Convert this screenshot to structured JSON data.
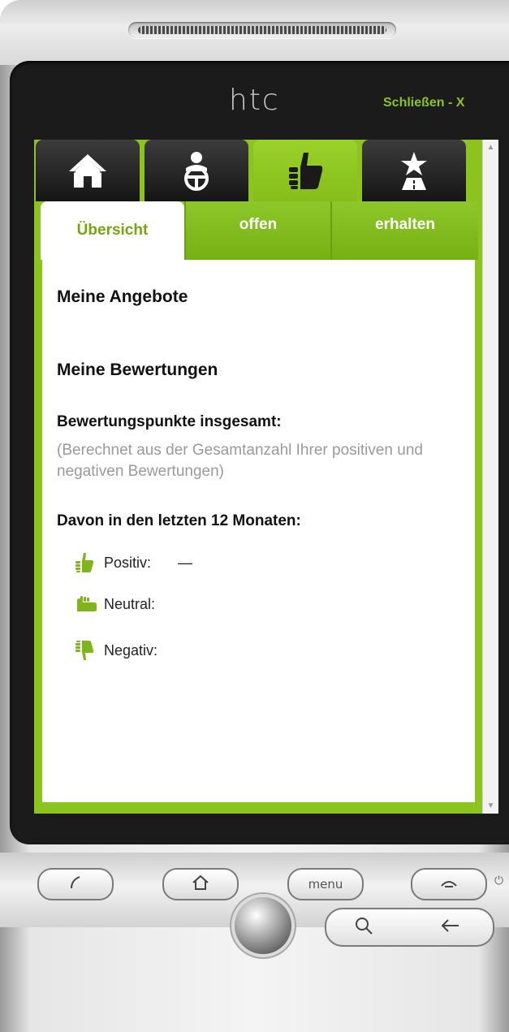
{
  "device": {
    "brand": "htc",
    "close_label": "Schließen - X",
    "hardware_buttons": {
      "menu_label": "menu"
    }
  },
  "nav": {
    "tabs": [
      {
        "name": "home",
        "icon": "home-icon",
        "active": false
      },
      {
        "name": "driver",
        "icon": "driver-icon",
        "active": false
      },
      {
        "name": "ratings",
        "icon": "thumbs-up-icon",
        "active": true
      },
      {
        "name": "road",
        "icon": "road-star-icon",
        "active": false
      }
    ]
  },
  "subtabs": {
    "overview": "Übersicht",
    "open": "offen",
    "received": "erhalten",
    "active": "overview"
  },
  "content": {
    "offers_heading": "Meine Angebote",
    "ratings_heading": "Meine Bewertungen",
    "total_points_label": "Bewertungspunkte insgesamt:",
    "total_points_note": "(Berechnet aus der Gesamtanzahl Ihrer positiven und negativen Bewertungen)",
    "last_12_label": "Davon in den letzten 12 Monaten:",
    "ratings": {
      "positive": {
        "label": "Positiv:",
        "value": "—",
        "icon": "thumbs-up-icon"
      },
      "neutral": {
        "label": "Neutral:",
        "value": "",
        "icon": "thumb-neutral-icon"
      },
      "negative": {
        "label": "Negativ:",
        "value": "",
        "icon": "thumbs-down-icon"
      }
    }
  },
  "colors": {
    "accent_green": "#8dc31f",
    "text_green": "#72a70e",
    "bezel": "#1b1b1b"
  }
}
